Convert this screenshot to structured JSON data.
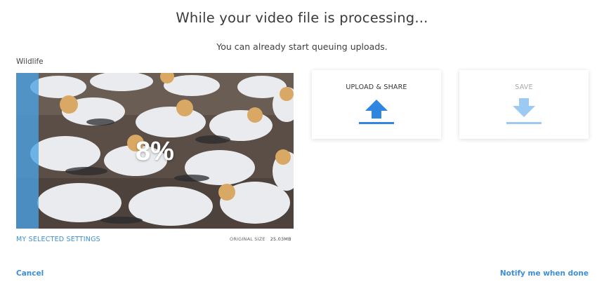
{
  "header": {
    "title": "While your video file is processing...",
    "subtitle": "You can already start queuing uploads."
  },
  "video": {
    "file_name": "Wildlife",
    "progress_label": "8%",
    "progress_value": 0.08,
    "settings_link": "MY SELECTED SETTINGS",
    "original_size_label": "ORIGINAL SIZE",
    "original_size_value": "25.03MB"
  },
  "actions": {
    "upload_share": {
      "label": "UPLOAD & SHARE",
      "icon": "upload-arrow-icon",
      "color": "#2f86e0"
    },
    "save": {
      "label": "SAVE",
      "icon": "download-arrow-icon",
      "color": "#9ccaf2"
    }
  },
  "footer": {
    "cancel": "Cancel",
    "notify": "Notify me when done"
  },
  "colors": {
    "accent": "#3c8ed6",
    "progress_overlay": "#4aa3e6"
  }
}
